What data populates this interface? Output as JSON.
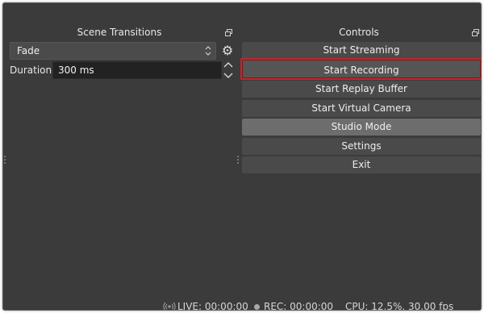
{
  "scene_transitions": {
    "title": "Scene Transitions",
    "transition_value": "Fade",
    "duration_label": "Duration",
    "duration_value": "300 ms"
  },
  "controls": {
    "title": "Controls",
    "buttons": [
      {
        "label": "Start Streaming"
      },
      {
        "label": "Start Recording"
      },
      {
        "label": "Start Replay Buffer"
      },
      {
        "label": "Start Virtual Camera"
      },
      {
        "label": "Studio Mode"
      },
      {
        "label": "Settings"
      },
      {
        "label": "Exit"
      }
    ]
  },
  "statusbar": {
    "live": "LIVE: 00:00:00",
    "rec": "REC: 00:00:00",
    "cpu": "CPU: 12.5%, 30.00 fps"
  },
  "colors": {
    "background": "#3b3b3b",
    "button": "#4a4a4a",
    "checked_button": "#6d6d6d",
    "highlight_border": "#c0262b"
  },
  "icons": {
    "gear": "gear-icon",
    "float": "dock-float-icon",
    "live": "broadcast-icon",
    "rec": "record-dot-icon"
  }
}
